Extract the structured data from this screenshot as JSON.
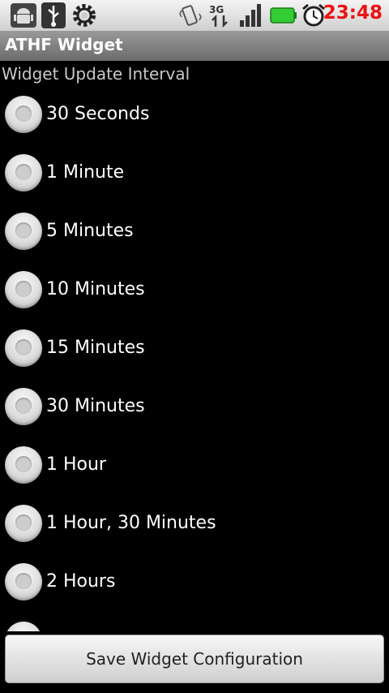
{
  "status_bar": {
    "time": "23:48",
    "icons": [
      "android-debug-icon",
      "usb-icon",
      "settings-gear-icon",
      "vibrate-icon",
      "3g-data-icon",
      "signal-icon",
      "battery-icon",
      "alarm-icon"
    ]
  },
  "title_bar": {
    "title": "ATHF Widget"
  },
  "section": {
    "label": "Widget Update Interval"
  },
  "options": [
    {
      "label": "30 Seconds"
    },
    {
      "label": "1 Minute"
    },
    {
      "label": "5 Minutes"
    },
    {
      "label": "10 Minutes"
    },
    {
      "label": "15 Minutes"
    },
    {
      "label": "30 Minutes"
    },
    {
      "label": "1 Hour"
    },
    {
      "label": "1 Hour, 30 Minutes"
    },
    {
      "label": "2 Hours"
    }
  ],
  "save_button": {
    "label": "Save Widget Configuration"
  },
  "colors": {
    "clock": "#ee1111",
    "background": "#000000"
  }
}
